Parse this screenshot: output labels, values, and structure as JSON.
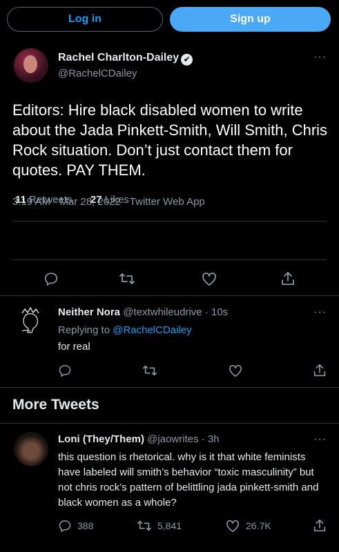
{
  "top_bar": {
    "login_label": "Log in",
    "signup_label": "Sign up"
  },
  "main_tweet": {
    "author_name": "Rachel Charlton-Dailey",
    "verified_mark": "✔",
    "author_handle": "@RachelCDailey",
    "more_label": "···",
    "text": "Editors: Hire black disabled women to write about the Jada Pinkett-Smith, Will Smith, Chris Rock situation. Don’t just contact them for quotes. PAY THEM.",
    "meta": "3:19 AM · Mar 28, 2022 · Twitter Web App",
    "retweets_count": "11",
    "retweets_label": "Retweets",
    "likes_count": "27",
    "likes_label": "Likes"
  },
  "reply": {
    "author_name": "Neither Nora",
    "author_handle": "@textwhileudrive",
    "time": "· 10s",
    "replying_prefix": "Replying to",
    "replying_handle": "@RachelCDailey",
    "text": "for real",
    "more_label": "···"
  },
  "more_tweets": {
    "section_title": "More Tweets",
    "tweet": {
      "author_name": "Loni (They/Them)",
      "author_handle": "@jaowrites",
      "time": "· 3h",
      "text": "this question is rhetorical. why is it that white feminists have labeled will smith’s behavior “toxic masculinity” but not chris rock’s pattern of belittling jada pinkett-smith and black women as a whole?",
      "replies": "388",
      "retweets": "5,841",
      "likes": "26.7K",
      "more_label": "···"
    }
  },
  "icons": [
    "reply-icon",
    "retweet-icon",
    "like-icon",
    "share-icon",
    "verified-icon",
    "more-icon"
  ],
  "colors": {
    "background": "#000000",
    "accent": "#1d9bf0",
    "signup_bg": "#4aa8f5",
    "text_secondary": "#8b98a5",
    "divider": "#2f3336"
  }
}
